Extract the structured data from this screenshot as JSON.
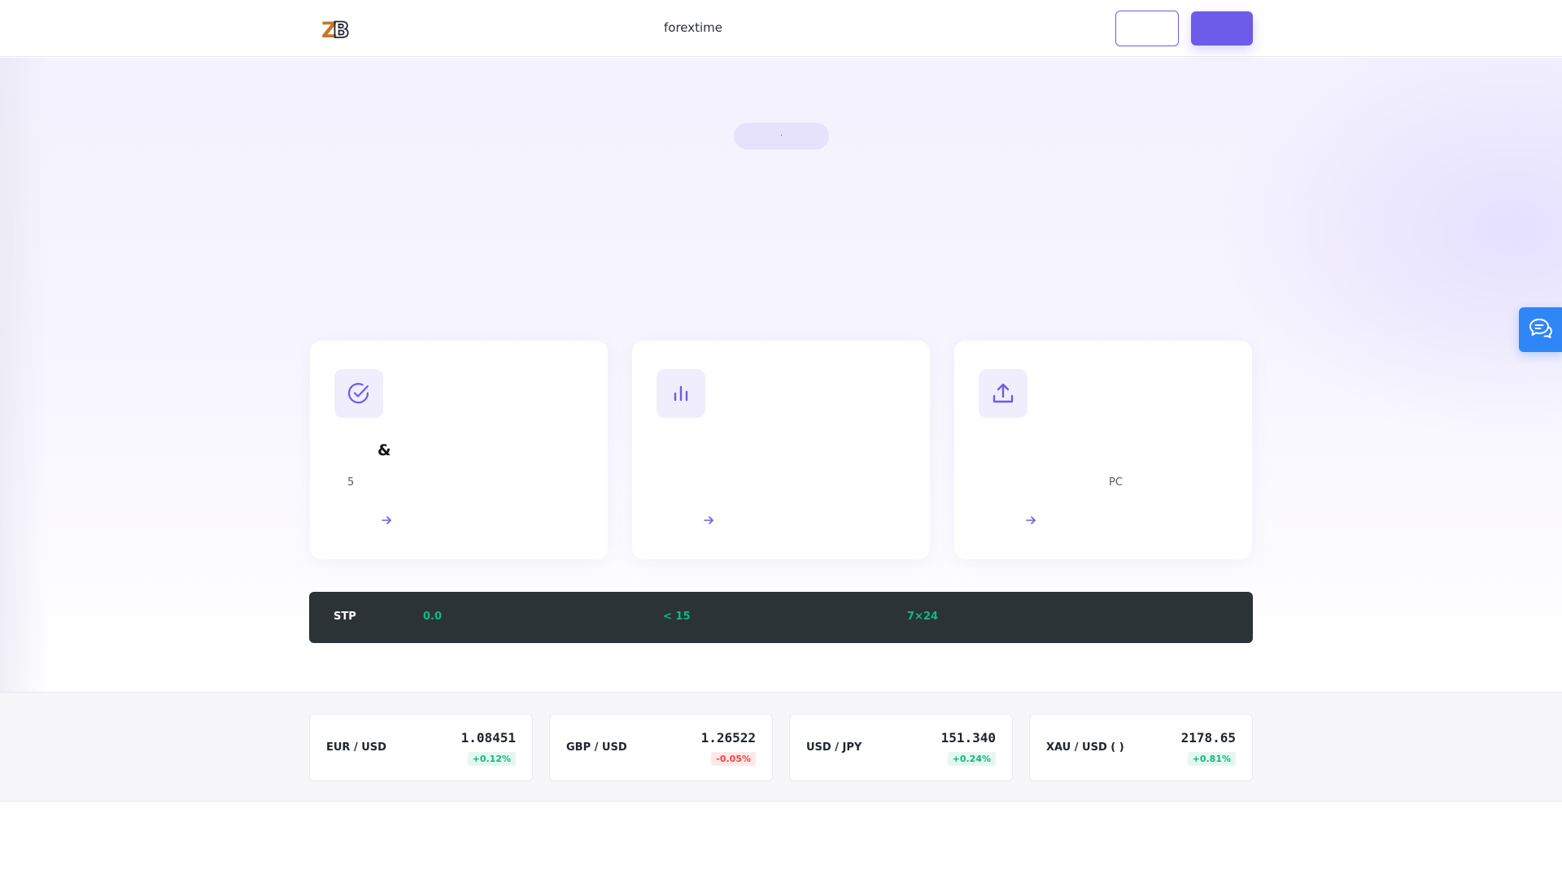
{
  "header": {
    "brand": "forextime",
    "login_label": "",
    "signup_label": ""
  },
  "hero": {
    "pill_text": "·"
  },
  "features": [
    {
      "icon": "check-circle-icon",
      "title": "&",
      "description": "5"
    },
    {
      "icon": "bar-chart-icon",
      "title": "",
      "description": ""
    },
    {
      "icon": "upload-icon",
      "title": "",
      "description": "PC"
    }
  ],
  "stats": {
    "label": "STP",
    "values": [
      "0.0",
      "< 15",
      "7×24"
    ]
  },
  "quotes": [
    {
      "pair": "EUR / USD",
      "price": "1.08451",
      "change": "+0.12%",
      "direction": "up"
    },
    {
      "pair": "GBP / USD",
      "price": "1.26522",
      "change": "-0.05%",
      "direction": "down"
    },
    {
      "pair": "USD / JPY",
      "price": "151.340",
      "change": "+0.24%",
      "direction": "up"
    },
    {
      "pair": "XAU / USD (   )",
      "price": "2178.65",
      "change": "+0.81%",
      "direction": "up"
    }
  ],
  "colors": {
    "accent": "#6c5ce7",
    "stats_bg": "#2c3336",
    "positive": "#10b981",
    "negative": "#ef4444",
    "chat": "#2f86f6"
  },
  "chat": {
    "icon": "chat-bubbles-icon"
  }
}
